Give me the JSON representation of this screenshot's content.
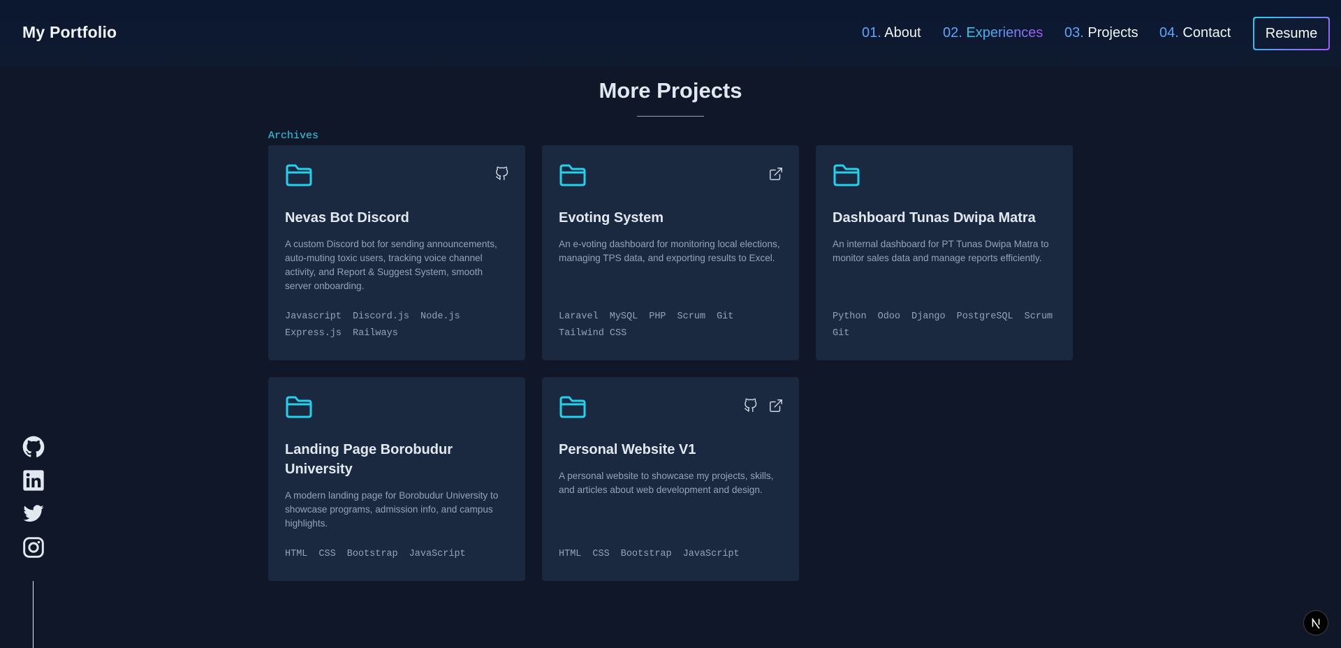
{
  "header": {
    "logo": "My Portfolio",
    "nav": [
      {
        "num": "01.",
        "label": "About"
      },
      {
        "num": "02.",
        "label": "Experiences"
      },
      {
        "num": "03.",
        "label": "Projects"
      },
      {
        "num": "04.",
        "label": "Contact"
      }
    ],
    "resume_label": "Resume"
  },
  "section": {
    "title": "More Projects",
    "archives_label": "Archives"
  },
  "projects": [
    {
      "title": "Nevas Bot Discord",
      "description": "A custom Discord bot for sending announcements, auto-muting toxic users, tracking voice channel activity, and Report & Suggest System, smooth server onboarding.",
      "tags": [
        "Javascript",
        "Discord.js",
        "Node.js",
        "Express.js",
        "Railways"
      ],
      "icons": [
        "github-icon"
      ]
    },
    {
      "title": "Evoting System",
      "description": "An e-voting dashboard for monitoring local elections, managing TPS data, and exporting results to Excel.",
      "tags": [
        "Laravel",
        "MySQL",
        "PHP",
        "Scrum",
        "Git",
        "Tailwind CSS"
      ],
      "icons": [
        "external-link-icon"
      ]
    },
    {
      "title": "Dashboard Tunas Dwipa Matra",
      "description": "An internal dashboard for PT Tunas Dwipa Matra to monitor sales data and manage reports efficiently.",
      "tags": [
        "Python",
        "Odoo",
        "Django",
        "PostgreSQL",
        "Scrum",
        "Git"
      ],
      "icons": []
    },
    {
      "title": "Landing Page Borobudur University",
      "description": "A modern landing page for Borobudur University to showcase programs, admission info, and campus highlights.",
      "tags": [
        "HTML",
        "CSS",
        "Bootstrap",
        "JavaScript"
      ],
      "icons": []
    },
    {
      "title": "Personal Website V1",
      "description": "A personal website to showcase my projects, skills, and articles about web development and design.",
      "tags": [
        "HTML",
        "CSS",
        "Bootstrap",
        "JavaScript"
      ],
      "icons": [
        "github-icon",
        "external-link-icon"
      ]
    }
  ],
  "social_icons": [
    "github-icon",
    "linkedin-icon",
    "twitter-icon",
    "instagram-icon"
  ],
  "badge": "N",
  "colors": {
    "background": "#0f1729",
    "card": "#1b2940",
    "accent": "#22d3ee",
    "accent_purple": "#a855f7",
    "nav_number": "#60a5fa",
    "text_muted": "#94a3b8"
  }
}
